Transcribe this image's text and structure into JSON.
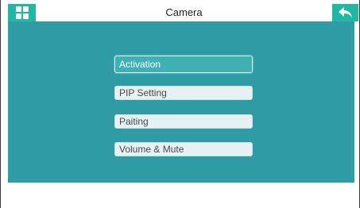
{
  "window": {
    "title": "Camera"
  },
  "header": {
    "menu_icon": "grid-menu-icon",
    "back_icon": "back-arrow-icon"
  },
  "menu": {
    "items": [
      {
        "label": "Activation",
        "selected": true
      },
      {
        "label": "PIP Setting",
        "selected": false
      },
      {
        "label": "Paiting",
        "selected": false
      },
      {
        "label": "Volume & Mute",
        "selected": false
      }
    ]
  },
  "colors": {
    "accent": "#1fb8a3",
    "panel": "#2e9ba5",
    "selected_item": "#3fb0b4",
    "item_bg": "#e6f1f2"
  }
}
